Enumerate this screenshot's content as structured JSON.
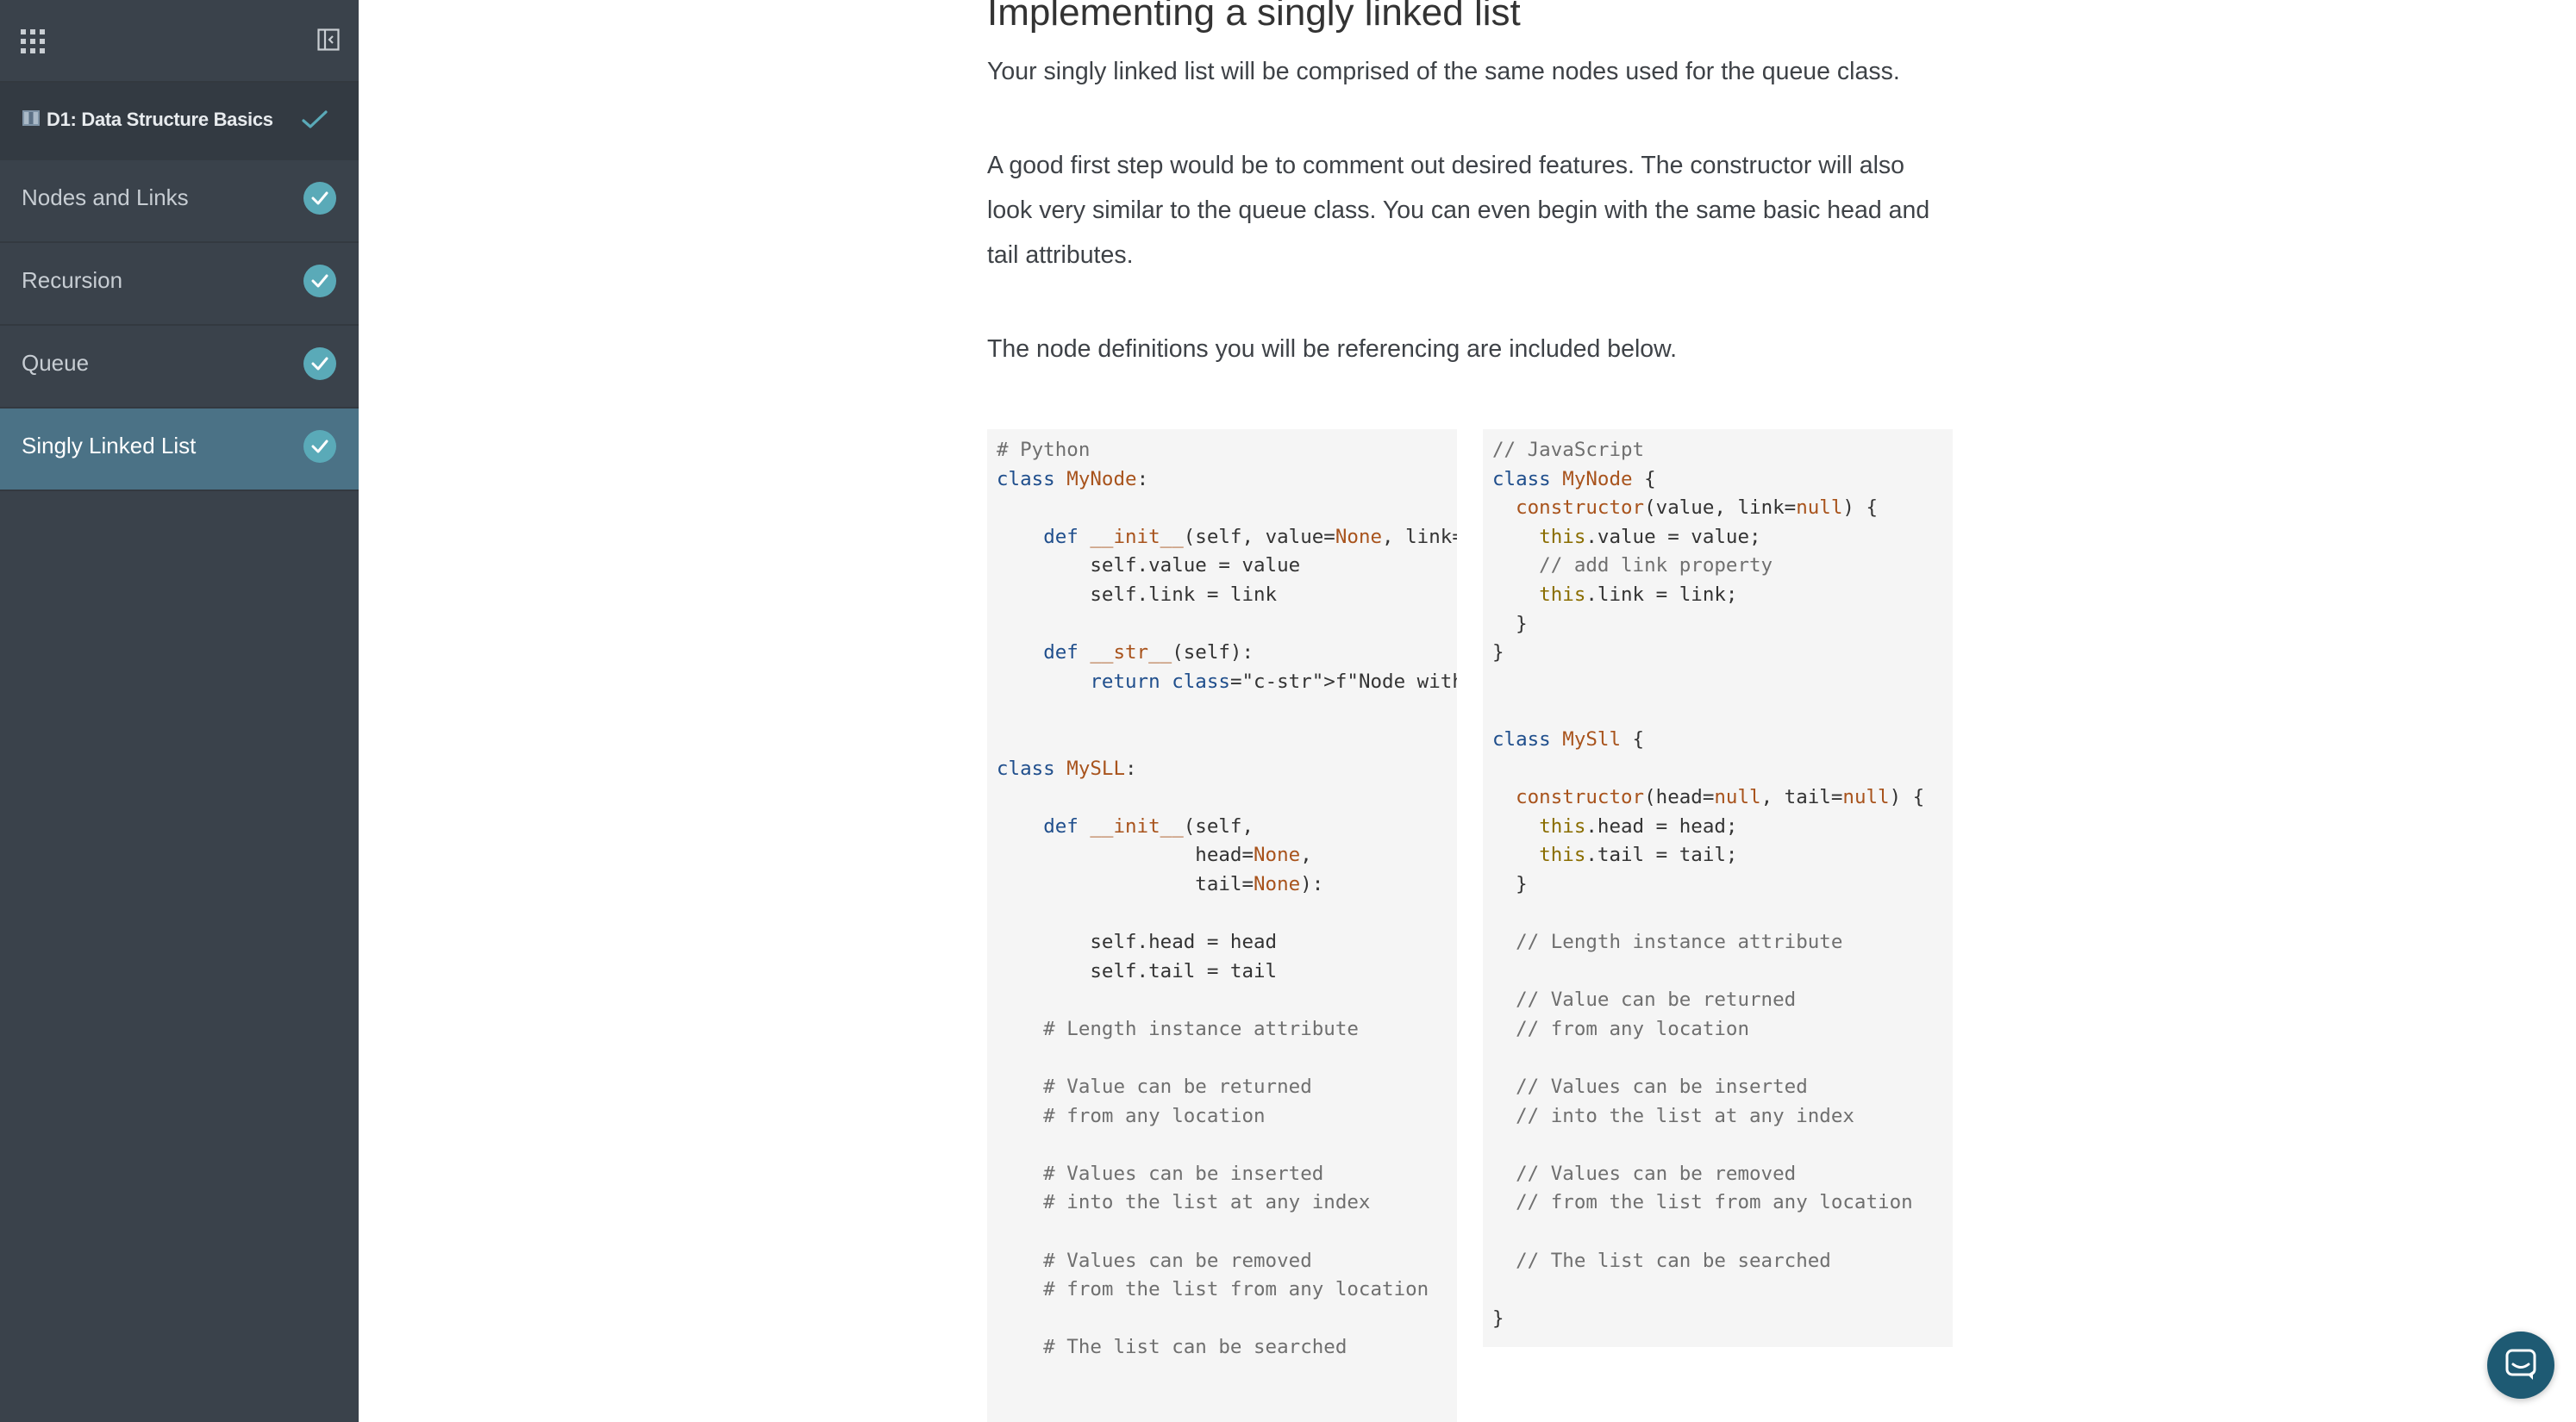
{
  "sidebar": {
    "module_title": "D1: Data Structure Basics",
    "items": [
      {
        "label": "Nodes and Links",
        "completed": true
      },
      {
        "label": "Recursion",
        "completed": true
      },
      {
        "label": "Queue",
        "completed": true
      },
      {
        "label": "Singly Linked List",
        "completed": true,
        "active": true
      }
    ]
  },
  "main": {
    "heading": "Implementing a singly linked list",
    "paragraphs": [
      "Your singly linked list will be comprised of the same nodes used for the queue class.",
      "A good first step would be to comment out desired features. The constructor will also look very similar to the queue class. You can even begin with the same basic head and tail attributes.",
      "The node definitions you will be referencing are included below."
    ],
    "code_blocks": [
      {
        "language": "Python",
        "lines": [
          "# Python",
          "class MyNode:",
          "",
          "    def __init__(self, value=None, link=",
          "        self.value = value",
          "        self.link = link",
          "",
          "    def __str__(self):",
          "        return f\"Node with value:{self.v",
          "",
          "",
          "class MySLL:",
          "",
          "    def __init__(self,",
          "                 head=None,",
          "                 tail=None):",
          "",
          "        self.head = head",
          "        self.tail = tail",
          "",
          "    # Length instance attribute",
          "",
          "    # Value can be returned",
          "    # from any location",
          "",
          "    # Values can be inserted",
          "    # into the list at any index",
          "",
          "    # Values can be removed",
          "    # from the list from any location",
          "",
          "    # The list can be searched"
        ]
      },
      {
        "language": "JavaScript",
        "lines": [
          "// JavaScript",
          "class MyNode {",
          "  constructor(value, link=null) {",
          "    this.value = value;",
          "    // add link property",
          "    this.link = link;",
          "  }",
          "}",
          "",
          "",
          "class MySll {",
          "",
          "  constructor(head=null, tail=null) {",
          "    this.head = head;",
          "    this.tail = tail;",
          "  }",
          "",
          "  // Length instance attribute",
          "",
          "  // Value can be returned",
          "  // from any location",
          "",
          "  // Values can be inserted",
          "  // into the list at any index",
          "",
          "  // Values can be removed",
          "  // from the list from any location",
          "",
          "  // The list can be searched",
          "",
          "}"
        ]
      }
    ]
  },
  "icons": {
    "apps": "grid-icon",
    "collapse": "sidebar-collapse-icon",
    "chat": "chat-icon"
  },
  "colors": {
    "sidebar_bg": "#3a424b",
    "active_item_bg": "#4b7286",
    "check_badge": "#5aaab8",
    "chat_button": "#1e5a73"
  }
}
